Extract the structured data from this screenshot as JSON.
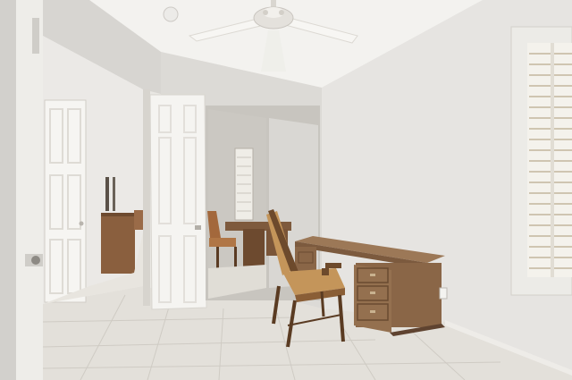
{
  "scene": {
    "kind": "photo",
    "subject": "home-office-room",
    "colors": {
      "ceiling": "#f3f2ef",
      "wall_right": "#e6e4e1",
      "wall_center": "#dcdad6",
      "wall_left": "#d8d6d2",
      "floor": "#e3e0da",
      "door_white": "#f5f4f1",
      "desk_wood": "#8a6647",
      "desk_top": "#9c7857",
      "chair_seat": "#c4955a",
      "chair_frame": "#6d4a2c",
      "shutter": "#f1efe9",
      "mirror": "#cfccc6"
    },
    "icons": [
      "ceiling-fan-icon",
      "outlet-icon"
    ]
  }
}
